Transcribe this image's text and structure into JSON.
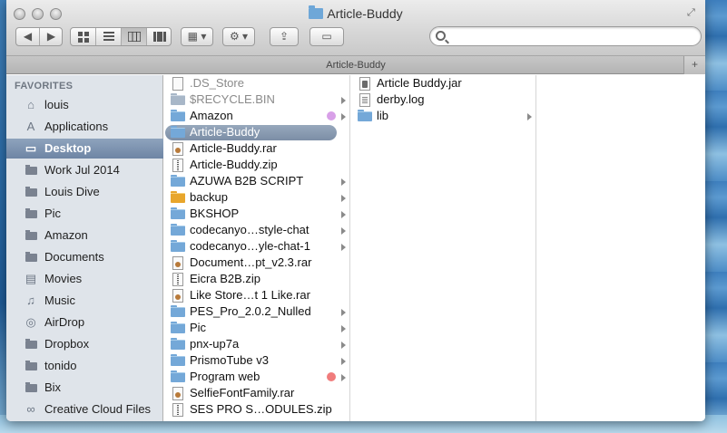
{
  "window": {
    "title": "Article-Buddy"
  },
  "pathbar": {
    "title": "Article-Buddy",
    "add_label": "+"
  },
  "toolbar": {
    "back_label": "◀",
    "forward_label": "▶",
    "action_label": "⚙ ▾",
    "arrange_label": "▦ ▾",
    "share_label": "⇪",
    "tag_label": "▭"
  },
  "search": {
    "placeholder": "",
    "value": ""
  },
  "sidebar": {
    "header": "FAVORITES",
    "items": [
      {
        "label": "louis",
        "icon": "home-icon"
      },
      {
        "label": "Applications",
        "icon": "applications-icon"
      },
      {
        "label": "Desktop",
        "icon": "desktop-icon",
        "selected": true
      },
      {
        "label": "Work Jul 2014",
        "icon": "folder-icon"
      },
      {
        "label": "Louis Dive",
        "icon": "folder-icon"
      },
      {
        "label": "Pic",
        "icon": "folder-icon"
      },
      {
        "label": "Amazon",
        "icon": "folder-icon"
      },
      {
        "label": "Documents",
        "icon": "folder-icon"
      },
      {
        "label": "Movies",
        "icon": "film-icon"
      },
      {
        "label": "Music",
        "icon": "music-icon"
      },
      {
        "label": "AirDrop",
        "icon": "airdrop-icon"
      },
      {
        "label": "Dropbox",
        "icon": "folder-icon"
      },
      {
        "label": "tonido",
        "icon": "folder-icon"
      },
      {
        "label": "Bix",
        "icon": "folder-icon"
      },
      {
        "label": "Creative Cloud Files",
        "icon": "creative-cloud-icon"
      }
    ]
  },
  "column1": {
    "items": [
      {
        "label": ".DS_Store",
        "icon": "document-icon"
      },
      {
        "label": "$RECYCLE.BIN",
        "icon": "folder-icon"
      },
      {
        "label": "Amazon",
        "icon": "folder-icon",
        "tag": "#d8a0e8"
      },
      {
        "label": "Article-Buddy",
        "icon": "folder-icon",
        "selected": true
      },
      {
        "label": "Article-Buddy.rar",
        "icon": "archive-icon"
      },
      {
        "label": "Article-Buddy.zip",
        "icon": "zip-icon"
      },
      {
        "label": "AZUWA B2B SCRIPT",
        "icon": "folder-icon"
      },
      {
        "label": "backup",
        "icon": "folder-icon"
      },
      {
        "label": "BKSHOP",
        "icon": "folder-icon"
      },
      {
        "label": "codecanyo…style-chat",
        "icon": "folder-icon"
      },
      {
        "label": "codecanyo…yle-chat-1",
        "icon": "folder-icon"
      },
      {
        "label": "Document…pt_v2.3.rar",
        "icon": "archive-icon"
      },
      {
        "label": "Eicra B2B.zip",
        "icon": "zip-icon"
      },
      {
        "label": "Like Store…t 1 Like.rar",
        "icon": "archive-icon"
      },
      {
        "label": "PES_Pro_2.0.2_Nulled",
        "icon": "folder-icon"
      },
      {
        "label": "Pic",
        "icon": "folder-icon"
      },
      {
        "label": "pnx-up7a",
        "icon": "folder-icon"
      },
      {
        "label": "PrismoTube v3",
        "icon": "folder-icon"
      },
      {
        "label": "Program web",
        "icon": "folder-icon",
        "tag": "#f07c7c"
      },
      {
        "label": "SelfieFontFamily.rar",
        "icon": "archive-icon"
      },
      {
        "label": "SES PRO S…ODULES.zip",
        "icon": "zip-icon"
      }
    ]
  },
  "column2": {
    "items": [
      {
        "label": "Article Buddy.jar",
        "icon": "jar-icon"
      },
      {
        "label": "derby.log",
        "icon": "log-icon"
      },
      {
        "label": "lib",
        "icon": "folder-icon"
      }
    ]
  },
  "colors": {
    "selection": "#7c8ea6",
    "sidebar_bg": "#dfe4ea",
    "folder_blue": "#74a8d8",
    "folder_orange": "#e8a62c"
  }
}
